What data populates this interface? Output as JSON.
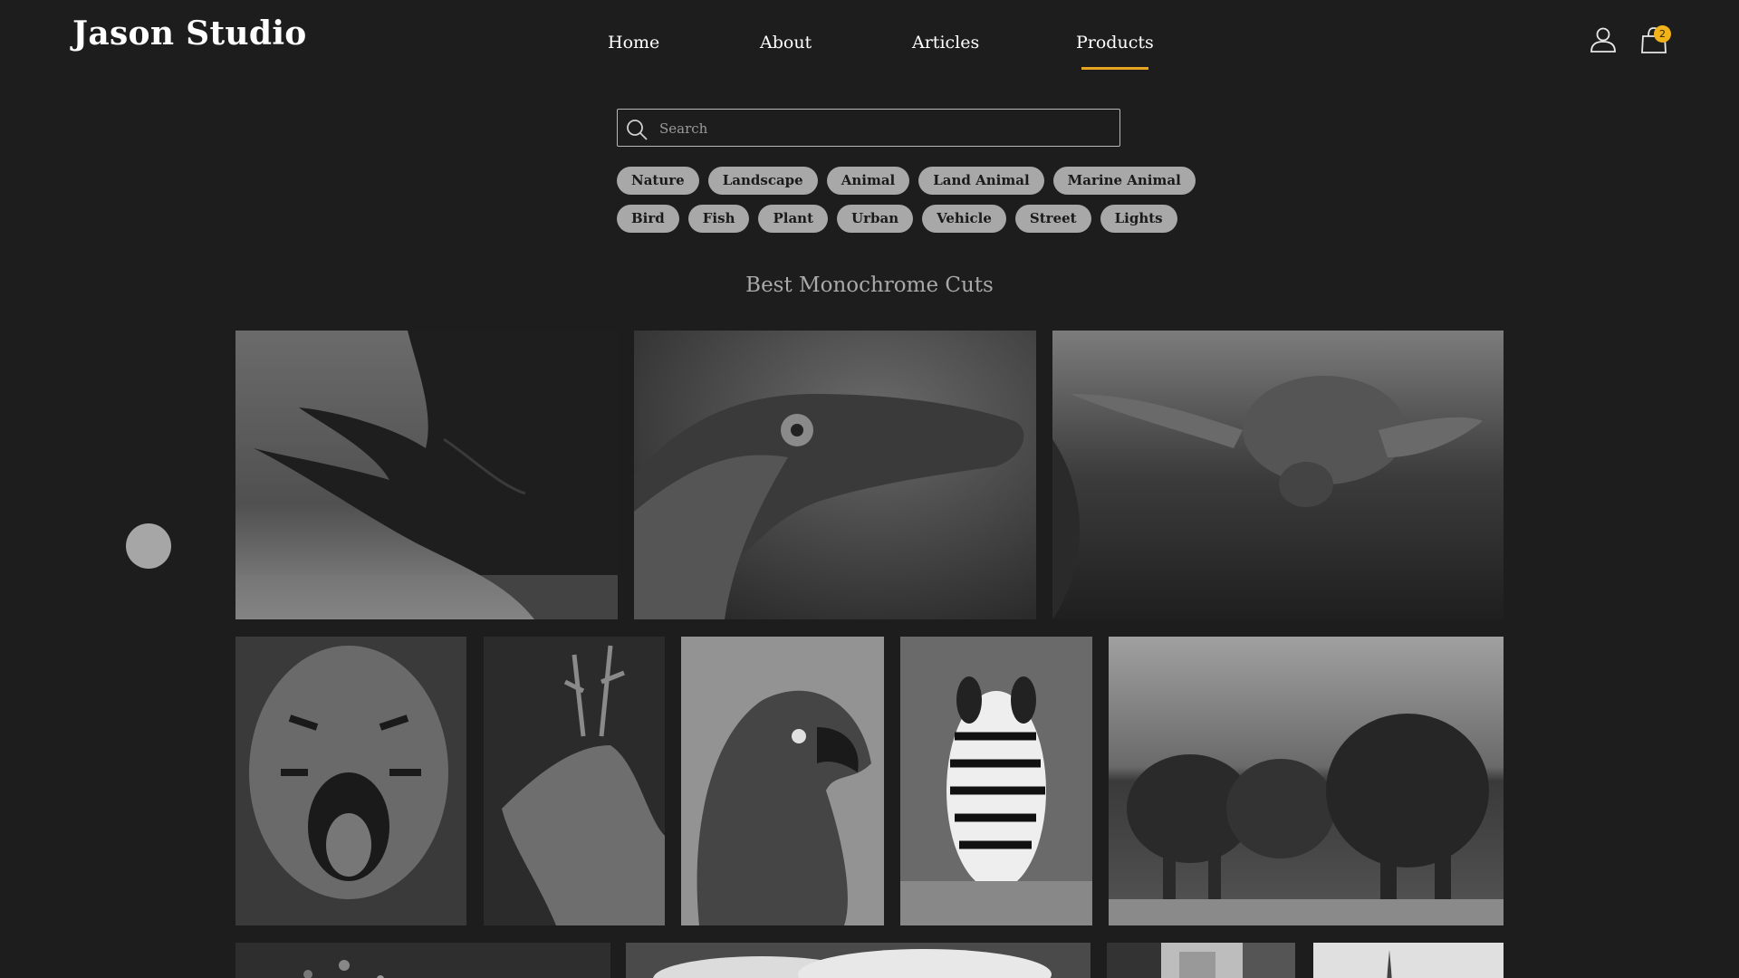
{
  "brand": {
    "name": "Jason Studio"
  },
  "nav": {
    "items": [
      {
        "label": "Home"
      },
      {
        "label": "About"
      },
      {
        "label": "Articles"
      },
      {
        "label": "Products"
      }
    ],
    "active": "Products"
  },
  "header": {
    "account_icon": "user-icon",
    "cart_icon": "shopping-bag-icon",
    "cart_count": "2",
    "accent_color": "#e7a422"
  },
  "search": {
    "placeholder": "Search",
    "icon": "search-icon"
  },
  "tags": {
    "row1": [
      "Nature",
      "Landscape",
      "Animal",
      "Land Animal",
      "Marine Animal"
    ],
    "row2": [
      "Bird",
      "Fish",
      "Plant",
      "Urban",
      "Vehicle",
      "Street",
      "Lights"
    ]
  },
  "gallery": {
    "title": "Best Monochrome Cuts",
    "photos": [
      {
        "subject": "rhino"
      },
      {
        "subject": "crocodile"
      },
      {
        "subject": "sea turtle"
      },
      {
        "subject": "tiger"
      },
      {
        "subject": "deer"
      },
      {
        "subject": "parrot"
      },
      {
        "subject": "zebra"
      },
      {
        "subject": "elephants"
      },
      {
        "subject": "forest"
      },
      {
        "subject": "clouds"
      },
      {
        "subject": "city street"
      },
      {
        "subject": "tower"
      }
    ]
  }
}
